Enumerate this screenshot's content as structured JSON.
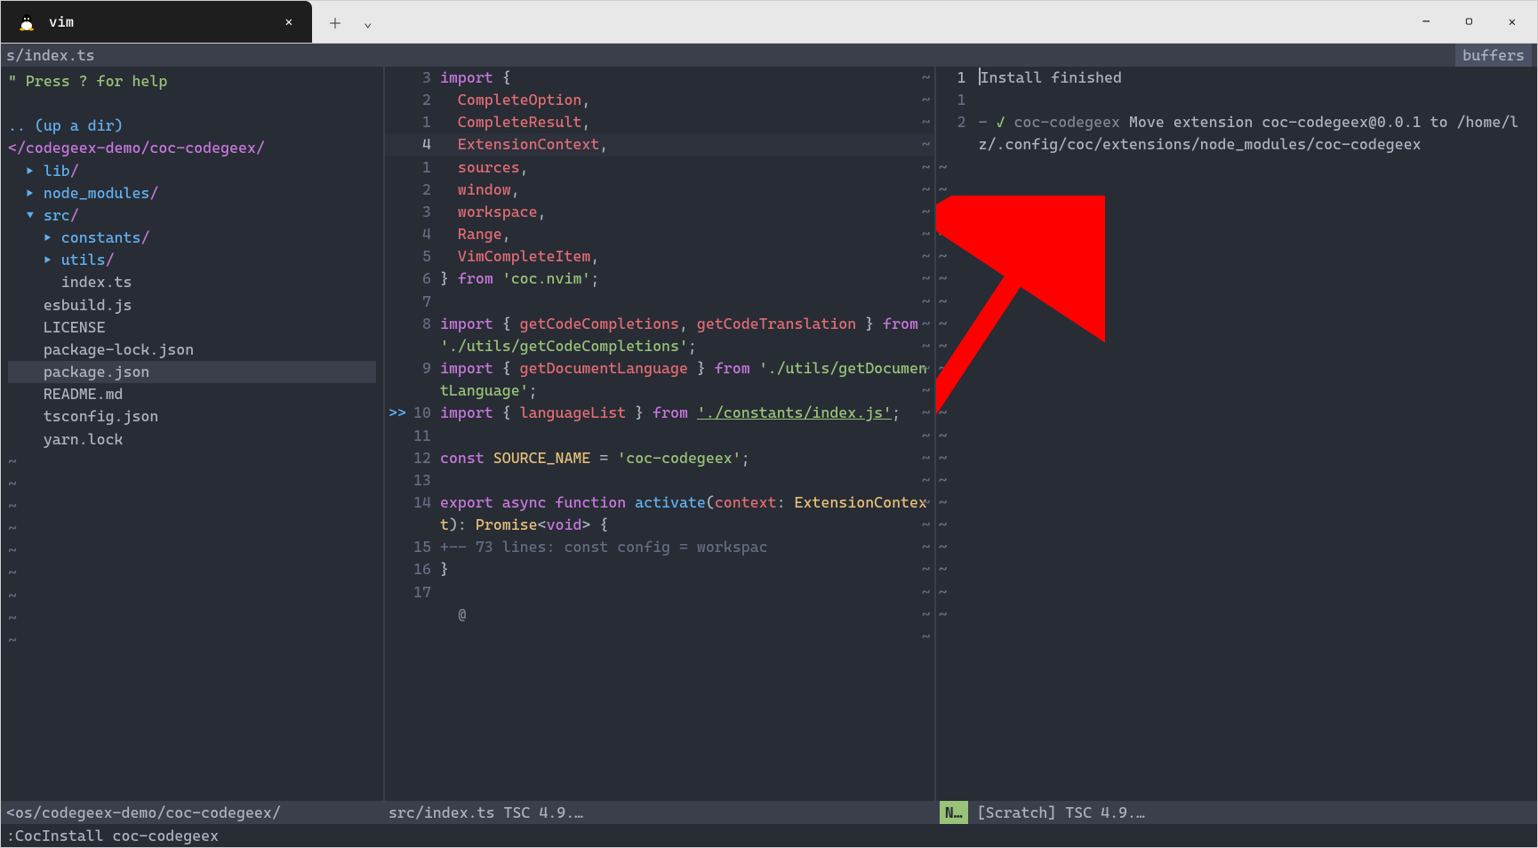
{
  "titlebar": {
    "tab": "vim"
  },
  "topbar": {
    "left": "s/index.ts",
    "right": "buffers"
  },
  "tree": {
    "help": "\" Press ? for help",
    "updir": ".. (up a dir)",
    "breadcrumb": "</codegeex-demo/coc-codegeex/",
    "items": [
      {
        "indent": 1,
        "arrow": "▸",
        "name": "lib",
        "dir": true
      },
      {
        "indent": 1,
        "arrow": "▸",
        "name": "node_modules",
        "dir": true
      },
      {
        "indent": 1,
        "arrow": "▾",
        "name": "src",
        "dir": true
      },
      {
        "indent": 2,
        "arrow": "▸",
        "name": "constants",
        "dir": true
      },
      {
        "indent": 2,
        "arrow": "▸",
        "name": "utils",
        "dir": true
      },
      {
        "indent": 2,
        "arrow": "",
        "name": "index.ts",
        "dir": false
      },
      {
        "indent": 1,
        "arrow": "",
        "name": "esbuild.js",
        "dir": false
      },
      {
        "indent": 1,
        "arrow": "",
        "name": "LICENSE",
        "dir": false
      },
      {
        "indent": 1,
        "arrow": "",
        "name": "package-lock.json",
        "dir": false
      },
      {
        "indent": 1,
        "arrow": "",
        "name": "package.json",
        "dir": false,
        "hl": true
      },
      {
        "indent": 1,
        "arrow": "",
        "name": "README.md",
        "dir": false
      },
      {
        "indent": 1,
        "arrow": "",
        "name": "tsconfig.json",
        "dir": false
      },
      {
        "indent": 1,
        "arrow": "",
        "name": "yarn.lock",
        "dir": false
      }
    ]
  },
  "code": {
    "lines": [
      {
        "n": "3",
        "html": "<span class='kw'>import</span> <span class='punct'>{</span>"
      },
      {
        "n": "2",
        "html": "  <span class='ident2'>CompleteOption</span><span class='comma'>,</span>"
      },
      {
        "n": "1",
        "html": "  <span class='ident2'>CompleteResult</span><span class='comma'>,</span>"
      },
      {
        "n": "4",
        "active": true,
        "cursor": true,
        "html": "  <span class='ident2'>ExtensionContext</span><span class='comma'>,</span>"
      },
      {
        "n": "1",
        "html": "  <span class='ident2'>sources</span><span class='comma'>,</span>"
      },
      {
        "n": "2",
        "html": "  <span class='ident2'>window</span><span class='comma'>,</span>"
      },
      {
        "n": "3",
        "html": "  <span class='ident2'>workspace</span><span class='comma'>,</span>"
      },
      {
        "n": "4",
        "html": "  <span class='ident2'>Range</span><span class='comma'>,</span>"
      },
      {
        "n": "5",
        "html": "  <span class='ident2'>VimCompleteItem</span><span class='comma'>,</span>"
      },
      {
        "n": "6",
        "html": "<span class='punct'>}</span> <span class='kw'>from</span> <span class='str'>'coc.nvim'</span><span class='punct'>;</span>"
      },
      {
        "n": "7",
        "html": ""
      },
      {
        "n": "8",
        "html": "<span class='kw'>import</span> <span class='punct'>{</span> <span class='ident2'>getCodeCompletions</span><span class='comma'>,</span> <span class='ident2'>getCodeTranslation</span> <span class='punct'>}</span> <span class='kw'>from</span> <span class='str'>'./utils/getCodeCompletions'</span><span class='punct'>;</span>"
      },
      {
        "n": "9",
        "html": "<span class='kw'>import</span> <span class='punct'>{</span> <span class='ident2'>getDocumentLanguage</span> <span class='punct'>}</span> <span class='kw'>from</span> <span class='str'>'./utils/getDocumentLanguage'</span><span class='punct'>;</span>"
      },
      {
        "n": "10",
        "sign": ">>",
        "html": "<span class='kw'>import</span> <span class='punct'>{</span> <span class='ident2'>languageList</span> <span class='punct'>}</span> <span class='kw'>from</span> <span class='hl-underline link-ul'>'./constants/index.js'</span><span class='punct'>;</span>"
      },
      {
        "n": "11",
        "html": ""
      },
      {
        "n": "12",
        "html": "<span class='kw'>const</span> <span class='ident'>SOURCE_NAME</span> <span class='punct'>=</span> <span class='str'>'coc-codegeex'</span><span class='punct'>;</span>"
      },
      {
        "n": "13",
        "html": ""
      },
      {
        "n": "14",
        "html": "<span class='kw'>export</span> <span class='kw'>async</span> <span class='kw'>function</span> <span class='func'>activate</span><span class='punct'>(</span><span class='ident2'>context</span><span class='punct'>:</span> <span class='ident'>ExtensionContext</span><span class='punct'>):</span> <span class='ident'>Promise</span><span class='punct'>&lt;</span><span class='kw'>void</span><span class='punct'>&gt; {</span>"
      },
      {
        "n": "15",
        "html": "<span class='fold'>+-- 73 lines: const config = workspac</span>"
      },
      {
        "n": "16",
        "html": "<span class='punct'>}</span>"
      },
      {
        "n": "17",
        "html": ""
      },
      {
        "n": "",
        "html": "  <span class='dim'>@</span>"
      }
    ]
  },
  "log": {
    "lines": [
      {
        "n": "1",
        "html": "<span class='cursor-caret'></span><span class='log-msg'>Install finished</span>"
      },
      {
        "n": "1",
        "dim": true,
        "html": ""
      },
      {
        "n": "2",
        "dim": true,
        "html": "<span class='dim'>- </span><span class='check'>✓</span> <span class='dim'>coc-codegeex</span> <span class='log-msg'>Move extension coc-codegeex@0.0.1 to /home/lz/.config/coc/extensions/node_modules/coc-codegeex</span>"
      }
    ]
  },
  "status": {
    "left": "<os/codegeex-demo/coc-codegeex/",
    "mid": "src/index.ts  TSC 4.9.…",
    "right_mode": "N…",
    "right_rest": "[Scratch]  TSC 4.9.…"
  },
  "cmdline": ":CocInstall coc-codegeex"
}
